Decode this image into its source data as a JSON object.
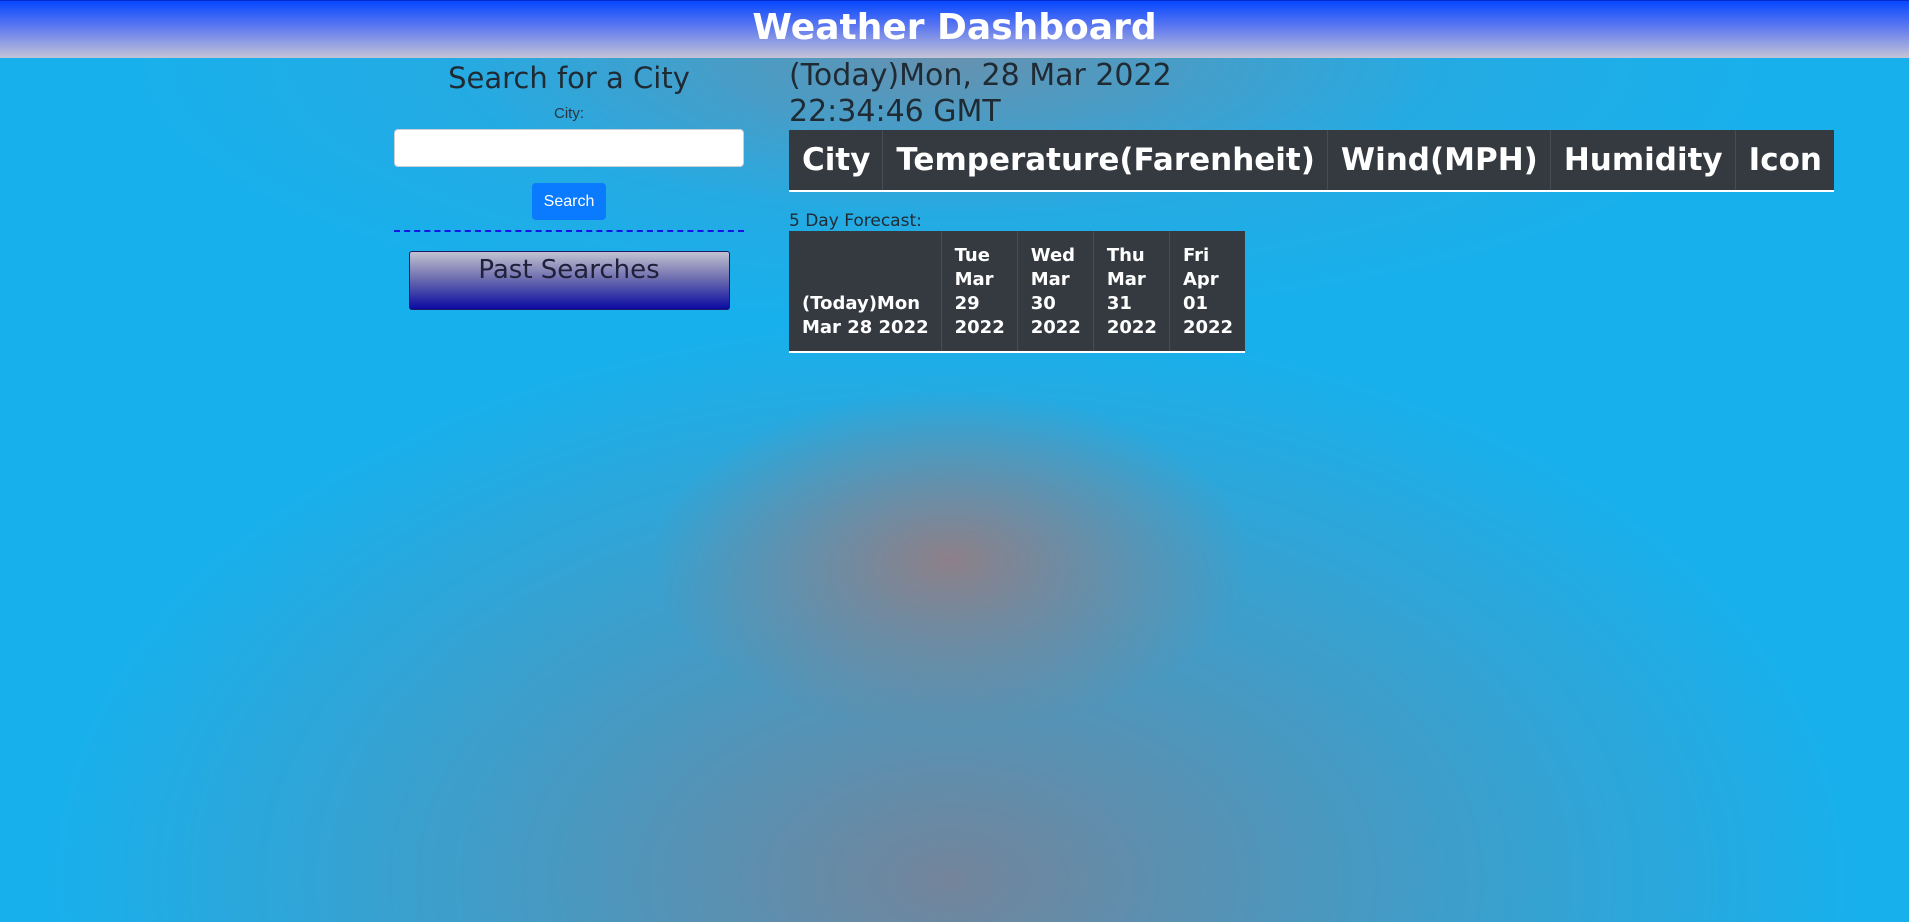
{
  "header": {
    "title": "Weather Dashboard"
  },
  "search": {
    "heading": "Search for a City",
    "city_label": "City:",
    "input_value": "",
    "button_label": "Search"
  },
  "past_searches": {
    "label": "Past Searches"
  },
  "current": {
    "date": "(Today)Mon, 28 Mar 2022",
    "time": "22:34:46 GMT",
    "columns": [
      "City",
      "Temperature(Farenheit)",
      "Wind(MPH)",
      "Humidity",
      "Icon"
    ]
  },
  "forecast": {
    "label": "5 Day Forecast:",
    "days": [
      {
        "line1": "",
        "line2": "",
        "line3": "(Today)Mon",
        "line4": "Mar 28 2022"
      },
      {
        "line1": "Tue",
        "line2": "Mar",
        "line3": "29",
        "line4": "2022"
      },
      {
        "line1": "Wed",
        "line2": "Mar",
        "line3": "30",
        "line4": "2022"
      },
      {
        "line1": "Thu",
        "line2": "Mar",
        "line3": "31",
        "line4": "2022"
      },
      {
        "line1": "Fri",
        "line2": "Apr",
        "line3": "01",
        "line4": "2022"
      }
    ]
  },
  "colors": {
    "background": "#18b0ec",
    "header_top": "#0648ff",
    "table_bg": "#343a40",
    "search_button": "#0a7bff",
    "divider": "#1414e6"
  }
}
